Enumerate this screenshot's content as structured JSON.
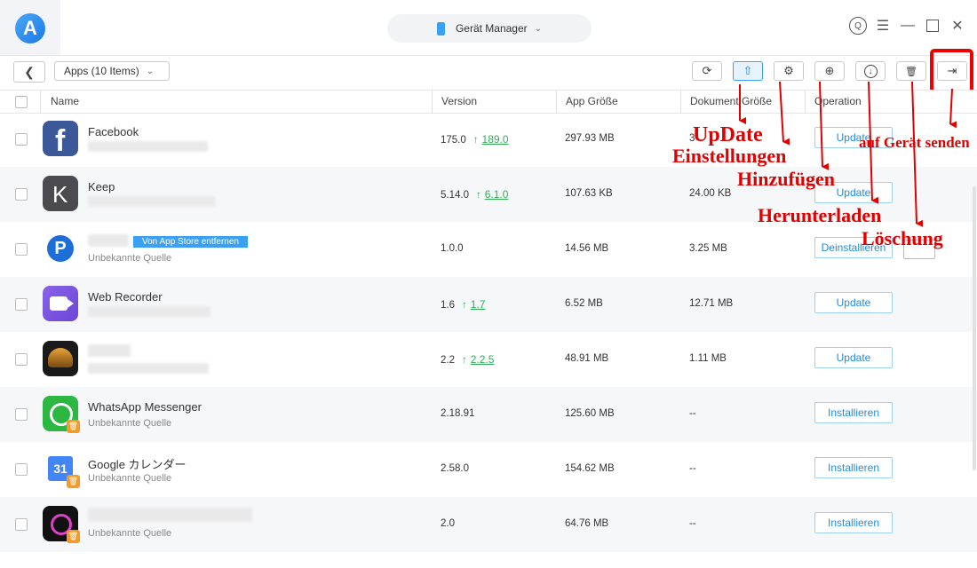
{
  "titlebar": {
    "logo_letter": "A",
    "device_name": "Gerät Manager"
  },
  "toolbar": {
    "back_glyph": "❮",
    "apps_dropdown": "Apps (10 Items)",
    "buttons": [
      {
        "name": "refresh-button",
        "icon": "refresh-icon",
        "glyph": "⟳"
      },
      {
        "name": "update-button",
        "icon": "upload-arrow-icon",
        "glyph": "⇧"
      },
      {
        "name": "settings-button",
        "icon": "gear-icon",
        "glyph": "⚙"
      },
      {
        "name": "add-button",
        "icon": "plus-circle-icon",
        "glyph": "⊕"
      },
      {
        "name": "download-button",
        "icon": "download-circle-icon",
        "glyph": "↓"
      },
      {
        "name": "delete-button",
        "icon": "trash-icon",
        "glyph": "🗑"
      },
      {
        "name": "send-to-device-button",
        "icon": "send-to-device-icon",
        "glyph": "⇥"
      }
    ]
  },
  "table": {
    "headers": [
      "Name",
      "Version",
      "App Größe",
      "Dokument Größe",
      "Operation"
    ],
    "rows": [
      {
        "name": "Facebook",
        "sub": "",
        "version": "175.0",
        "new_version": "189.0",
        "app_size": "297.93 MB",
        "doc_size": "3",
        "op": "Update",
        "icon": "facebook-icon"
      },
      {
        "name": "Keep",
        "sub": "",
        "version": "5.14.0",
        "new_version": "6.1.0",
        "app_size": "107.63 KB",
        "doc_size": "24.00 KB",
        "op": "Update",
        "icon": "keep-icon"
      },
      {
        "name": "",
        "tag": "Von App Store entfernen",
        "sub": "Unbekannte Quelle",
        "version": "1.0.0",
        "new_version": "",
        "app_size": "14.56 MB",
        "doc_size": "3.25 MB",
        "op": "Deinstallieren",
        "icon": "p-app-icon"
      },
      {
        "name": "Web Recorder",
        "sub": "",
        "version": "1.6",
        "new_version": "1.7",
        "app_size": "6.52 MB",
        "doc_size": "12.71 MB",
        "op": "Update",
        "icon": "web-recorder-icon"
      },
      {
        "name": "",
        "sub": "",
        "version": "2.2",
        "new_version": "2.2.5",
        "app_size": "48.91 MB",
        "doc_size": "1.11 MB",
        "op": "Update",
        "icon": "speedometer-app-icon"
      },
      {
        "name": "WhatsApp Messenger",
        "sub": "Unbekannte Quelle",
        "version": "2.18.91",
        "new_version": "",
        "app_size": "125.60 MB",
        "doc_size": "--",
        "op": "Installieren",
        "icon": "whatsapp-icon"
      },
      {
        "name": "Google カレンダー",
        "sub": "Unbekannte Quelle",
        "version": "2.58.0",
        "new_version": "",
        "app_size": "154.62 MB",
        "doc_size": "--",
        "op": "Installieren",
        "icon": "google-calendar-icon"
      },
      {
        "name": "",
        "sub": "Unbekannte Quelle",
        "version": "2.0",
        "new_version": "",
        "app_size": "64.76 MB",
        "doc_size": "--",
        "op": "Installieren",
        "icon": "ring-app-icon"
      }
    ]
  },
  "annotations": {
    "update": "UpDate",
    "settings": "Einstellungen",
    "add": "Hinzufügen",
    "download": "Herunterladen",
    "delete": "Löschung",
    "send": "auf Gerät senden"
  },
  "colors": {
    "accent": "#1d8be8",
    "annotation": "#e00000",
    "update_green": "#2fae56"
  }
}
